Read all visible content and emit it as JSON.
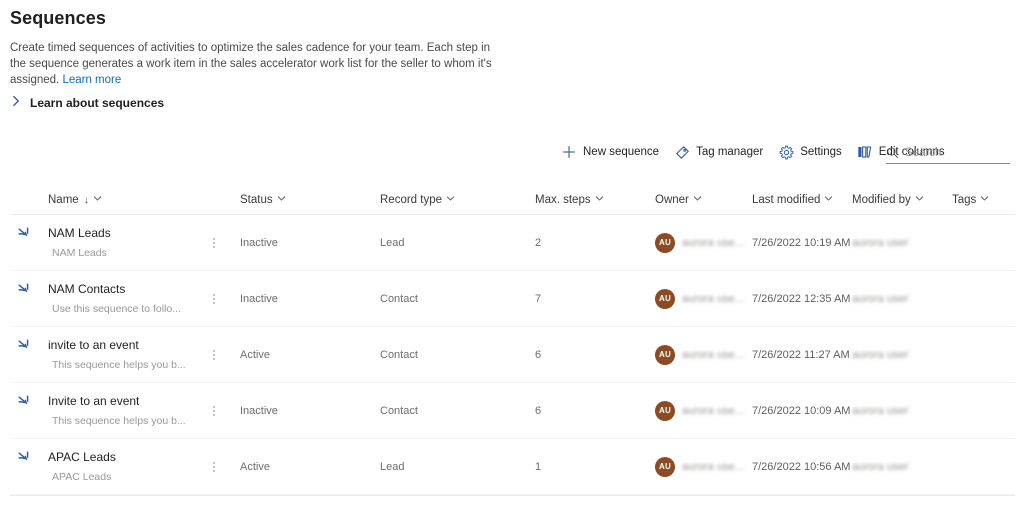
{
  "header": {
    "title": "Sequences",
    "description": "Create timed sequences of activities to optimize the sales cadence for your team. Each step in the sequence generates a work item in the sales accelerator work list for the seller to whom it's assigned.",
    "learn_more_label": "Learn more",
    "expander_label": "Learn about sequences"
  },
  "commandbar": {
    "new_sequence": "New sequence",
    "tag_manager": "Tag manager",
    "settings": "Settings",
    "edit_columns": "Edit columns"
  },
  "search": {
    "placeholder": "Search",
    "value": ""
  },
  "columns": {
    "name": "Name",
    "name_sort": "↓",
    "status": "Status",
    "record_type": "Record type",
    "max_steps": "Max. steps",
    "owner": "Owner",
    "last_modified": "Last modified",
    "modified_by": "Modified by",
    "tags": "Tags"
  },
  "rows": [
    {
      "name": "NAM Leads",
      "description": "NAM Leads",
      "status": "Inactive",
      "record_type": "Lead",
      "max_steps": "2",
      "owner_initials": "AU",
      "owner_name": "aurora use...",
      "last_modified": "7/26/2022 10:19 AM",
      "modified_by": "aurora user7",
      "tags": ""
    },
    {
      "name": "NAM Contacts",
      "description": "Use this sequence to follo...",
      "status": "Inactive",
      "record_type": "Contact",
      "max_steps": "7",
      "owner_initials": "AU",
      "owner_name": "aurora use...",
      "last_modified": "7/26/2022 12:35 AM",
      "modified_by": "aurora user7",
      "tags": ""
    },
    {
      "name": "invite to an event",
      "description": "This sequence helps you b...",
      "status": "Active",
      "record_type": "Contact",
      "max_steps": "6",
      "owner_initials": "AU",
      "owner_name": "aurora use...",
      "last_modified": "7/26/2022 11:27 AM",
      "modified_by": "aurora user7",
      "tags": ""
    },
    {
      "name": "Invite to an event",
      "description": "This sequence helps you b...",
      "status": "Inactive",
      "record_type": "Contact",
      "max_steps": "6",
      "owner_initials": "AU",
      "owner_name": "aurora use...",
      "last_modified": "7/26/2022 10:09 AM",
      "modified_by": "aurora user7",
      "tags": ""
    },
    {
      "name": "APAC Leads",
      "description": "APAC Leads",
      "status": "Active",
      "record_type": "Lead",
      "max_steps": "1",
      "owner_initials": "AU",
      "owner_name": "aurora use...",
      "last_modified": "7/26/2022 10:56 AM",
      "modified_by": "aurora user7",
      "tags": ""
    }
  ],
  "colors": {
    "link": "#0f6cbd",
    "icon_blue": "#2f5dab",
    "avatar": "#8b4c24"
  }
}
